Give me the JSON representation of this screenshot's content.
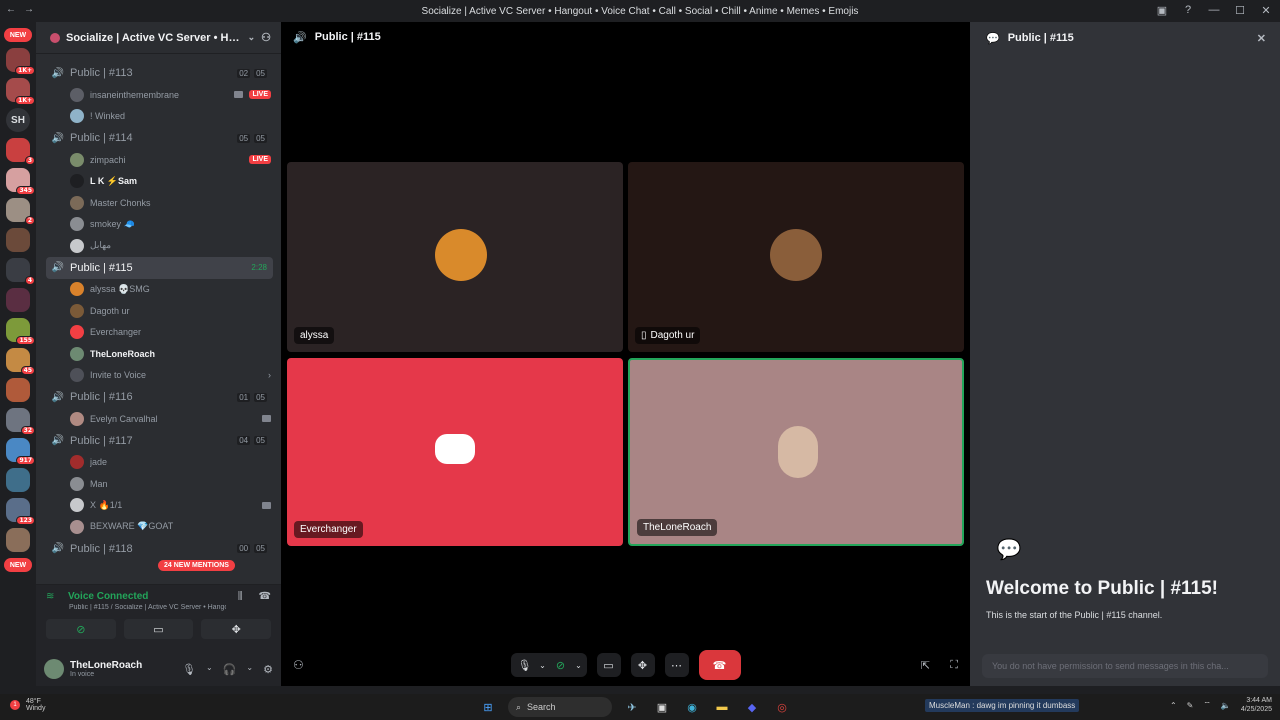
{
  "window": {
    "title": "Socialize | Active VC Server • Hangout • Voice Chat • Call • Social • Chill • Anime • Memes • Emojis"
  },
  "servers": {
    "new_top": "NEW",
    "new_bottom": "NEW",
    "sh_label": "SH",
    "badges": [
      "1K+",
      "1K+",
      "3",
      "345",
      "2",
      "4",
      "155",
      "45",
      "32",
      "917",
      "123"
    ]
  },
  "server_header": {
    "name": "Socialize | Active VC Server • Han..."
  },
  "channels": [
    {
      "name": "Public | #113",
      "count_a": "02",
      "count_b": "05",
      "users": [
        {
          "name": "insaneinthemembrane",
          "color": "#5c5e66",
          "live": "LIVE",
          "cam": true
        },
        {
          "name": "! Winked",
          "color": "#8fb3c9"
        }
      ]
    },
    {
      "name": "Public | #114",
      "count_a": "05",
      "count_b": "05",
      "users": [
        {
          "name": "zimpachi",
          "color": "#7a8c6b",
          "live": "LIVE"
        },
        {
          "name": "L K ⚡Sam",
          "color": "#1e1f22",
          "bright": true
        },
        {
          "name": "Master Chonks",
          "color": "#7b6a58"
        },
        {
          "name": "smokey 🧢",
          "color": "#8a8d92"
        },
        {
          "name": "مهابل",
          "color": "#c7c9cc"
        }
      ]
    },
    {
      "name": "Public | #115",
      "time": "2:28",
      "active": true,
      "users": [
        {
          "name": "alyssa 💀SMG",
          "color": "#d9822b"
        },
        {
          "name": "Dagoth ur",
          "color": "#7b5a38"
        },
        {
          "name": "Everchanger",
          "color": "#f23f43"
        },
        {
          "name": "TheLoneRoach",
          "color": "#6d8a72",
          "bright": true
        },
        {
          "name": "Invite to Voice",
          "color": "#4e5058",
          "invite": true
        }
      ]
    },
    {
      "name": "Public | #116",
      "count_a": "01",
      "count_b": "05",
      "users": [
        {
          "name": "Evelyn Carvalhal",
          "color": "#b08a82",
          "cam": true
        }
      ]
    },
    {
      "name": "Public | #117",
      "count_a": "04",
      "count_b": "05",
      "users": [
        {
          "name": "jade",
          "color": "#a12c2c"
        },
        {
          "name": "Man",
          "color": "#8a8d92"
        },
        {
          "name": "X 🔥1/1",
          "color": "#c7c9cc",
          "cam": true
        },
        {
          "name": "BEXWARE 💎GOAT",
          "color": "#a88f8f"
        }
      ]
    },
    {
      "name": "Public | #118",
      "count_a": "00",
      "count_b": "05",
      "users": []
    }
  ],
  "mentions_pill": "24 NEW MENTIONS",
  "voice_panel": {
    "status": "Voice Connected",
    "location": "Public | #115 / Socialize | Active VC Server • Hango..."
  },
  "user_panel": {
    "name": "TheLoneRoach",
    "status": "In voice"
  },
  "stage": {
    "header": "Public | #115",
    "tiles": [
      {
        "name": "alyssa",
        "bg": "#2b2324",
        "avatar": "#d98a2b"
      },
      {
        "name": "Dagoth ur",
        "bg": "#241714",
        "avatar": "#8a5e3a",
        "mobile": true
      },
      {
        "name": "Everchanger",
        "bg": "#e5384a",
        "avatar": "#ffffff"
      },
      {
        "name": "TheLoneRoach",
        "bg": "#a98585",
        "avatar": "#d6b9a4",
        "speaking": true
      }
    ]
  },
  "chat": {
    "header": "Public | #115",
    "welcome_title": "Welcome to Public | #115!",
    "welcome_sub": "This is the start of the Public | #115 channel.",
    "input_placeholder": "You do not have permission to send messages in this cha..."
  },
  "taskbar": {
    "temp": "48°F",
    "weather": "Windy",
    "search": "Search",
    "news": "MuscleMan : dawg im pinning it dumbass",
    "time": "3:44 AM",
    "date": "4/25/2025"
  },
  "colors": {
    "accent_green": "#23a55a",
    "danger_red": "#da373c",
    "blurple": "#5865f2"
  }
}
